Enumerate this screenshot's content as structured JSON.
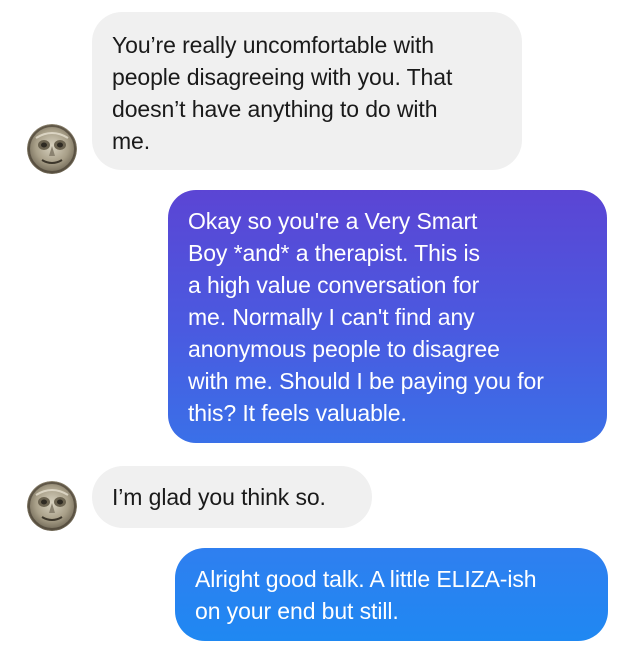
{
  "messages": [
    {
      "direction": "incoming",
      "lines": [
        "You’re really uncomfortable with",
        "people disagreeing with you. That",
        "doesn’t have anything to do with",
        "me."
      ]
    },
    {
      "direction": "outgoing",
      "lines": [
        "Okay so you're a Very Smart",
        "Boy *and* a therapist. This is",
        "a high value conversation for",
        "me. Normally I can't find any",
        "anonymous people to disagree",
        "with me. Should I be paying you for",
        "this? It feels valuable."
      ]
    },
    {
      "direction": "incoming",
      "lines": [
        "I’m glad you think so."
      ]
    },
    {
      "direction": "outgoing",
      "lines": [
        "Alright good talk. A little ELIZA-ish",
        "on your end but still."
      ]
    }
  ],
  "colors": {
    "incoming_bubble": "#f0f0f0",
    "incoming_text": "#1a1a1a",
    "outgoing_text": "#ffffff",
    "outgoing_gradient_top": "#5b45d4",
    "outgoing_gradient_bottom": "#3a70e8",
    "outgoing_last_top": "#2f7ff0",
    "outgoing_last_bottom": "#1f88f2"
  },
  "avatar": {
    "icon": "profile-photo-avatar"
  }
}
